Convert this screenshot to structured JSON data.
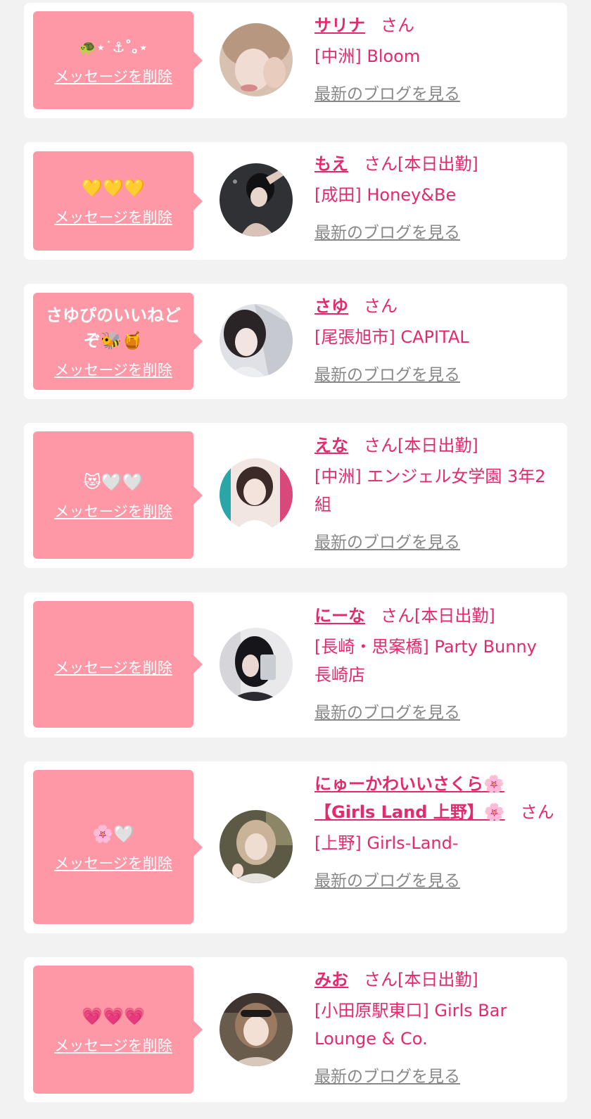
{
  "colors": {
    "accent": "#e6286e",
    "bubble": "#fe98a7",
    "link_gray": "#888888",
    "background": "#f2f2f3"
  },
  "items": [
    {
      "bubble_text": "🐢⋆˙⚓︎˚｡⋆",
      "delete_label": "メッセージを削除",
      "name": "サリナ",
      "honorific": "さん",
      "status": "",
      "shop": "[中洲] Bloom",
      "blog_label": "最新のブログを見る"
    },
    {
      "bubble_text": "💛💛💛",
      "delete_label": "メッセージを削除",
      "name": "もえ",
      "honorific": "さん",
      "status": "[本日出勤]",
      "shop": "[成田] Honey&Be",
      "blog_label": "最新のブログを見る"
    },
    {
      "bubble_text": "さゆぴのいいねどぞ🐝🍯",
      "delete_label": "メッセージを削除",
      "name": "さゆ",
      "honorific": "さん",
      "status": "",
      "shop": "[尾張旭市] CAPITAL",
      "blog_label": "最新のブログを見る"
    },
    {
      "bubble_text": "😻🤍🤍",
      "delete_label": "メッセージを削除",
      "name": "えな",
      "honorific": "さん",
      "status": "[本日出勤]",
      "shop": "[中洲] エンジェル女学園 3年2組",
      "blog_label": "最新のブログを見る"
    },
    {
      "bubble_text": "",
      "delete_label": "メッセージを削除",
      "name": "にーな",
      "honorific": "さん",
      "status": "[本日出勤]",
      "shop": "[長崎・思案橋] Party Bunny 長崎店",
      "blog_label": "最新のブログを見る"
    },
    {
      "bubble_text": "🌸🤍",
      "delete_label": "メッセージを削除",
      "name": "にゅーかわいいさくら🌸【Girls Land 上野】🌸",
      "honorific": "さん",
      "status": "",
      "shop": "[上野] Girls-Land-",
      "blog_label": "最新のブログを見る"
    },
    {
      "bubble_text": "💗💗💗",
      "delete_label": "メッセージを削除",
      "name": "みお",
      "honorific": "さん",
      "status": "[本日出勤]",
      "shop": "[小田原駅東口] Girls Bar Lounge & Co.",
      "blog_label": "最新のブログを見る"
    }
  ]
}
